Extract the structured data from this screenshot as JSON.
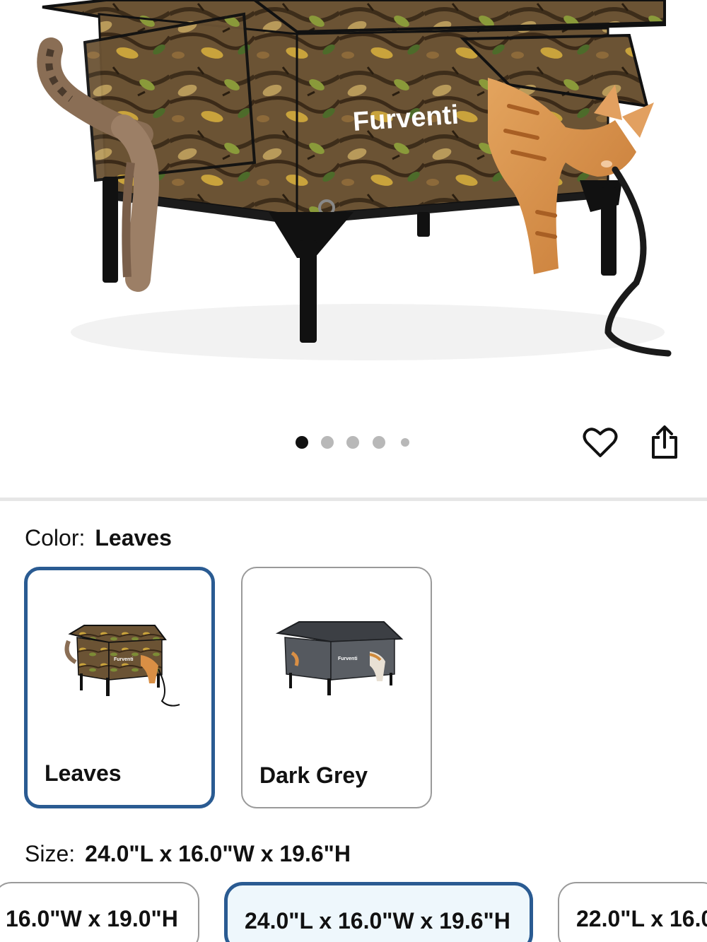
{
  "product": {
    "brand_text": "Furventi",
    "image_count": 5,
    "active_image": 1
  },
  "actions": {
    "favorite_icon": "heart-outline-icon",
    "share_icon": "share-icon"
  },
  "color": {
    "label": "Color:",
    "selected": "Leaves",
    "options": [
      {
        "name": "Leaves",
        "selected": true,
        "icon": "leaves-cat-house-thumbnail"
      },
      {
        "name": "Dark Grey",
        "selected": false,
        "icon": "dark-grey-cat-house-thumbnail"
      }
    ]
  },
  "size": {
    "label": "Size:",
    "selected": "24.0\"L x 16.0\"W x 19.6\"H",
    "options": [
      {
        "text": "16.0\"W x 19.0\"H",
        "selected": false
      },
      {
        "text": "24.0\"L x 16.0\"W x 19.6\"H",
        "selected": true
      },
      {
        "text": "22.0\"L x 16.0",
        "selected": false
      }
    ]
  },
  "colors": {
    "selected_border": "#2a5b92",
    "selected_fill": "#eef7fc",
    "dot_active": "#111111",
    "dot_inactive": "#b8b8b8"
  }
}
